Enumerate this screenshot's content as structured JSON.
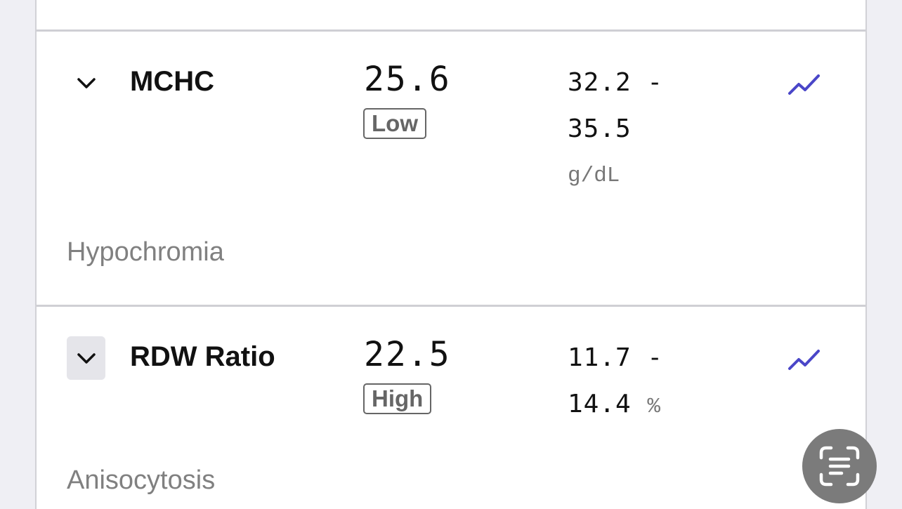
{
  "results": [
    {
      "name": "MCHC",
      "value": "25.6",
      "flag": "Low",
      "range_low": "32.2 -",
      "range_high": "35.5",
      "unit": "g/dL",
      "comment": "Hypochromia"
    },
    {
      "name": "RDW Ratio",
      "value": "22.5",
      "flag": "High",
      "range_low": "11.7 -",
      "range_high": "14.4",
      "unit": "%",
      "comment": "Anisocytosis"
    }
  ],
  "icons": {
    "expand": "chevron-down-icon",
    "trend": "trend-chart-icon",
    "scan": "scan-text-icon"
  },
  "colors": {
    "trend_accent": "#4a46c8",
    "flag_border": "#666666",
    "fab_background": "#7b7b7b"
  }
}
